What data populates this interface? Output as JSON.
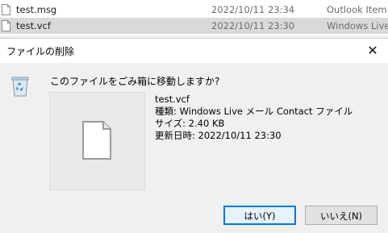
{
  "explorer": {
    "files": [
      {
        "name": "test.msg",
        "date": "2022/10/11 23:34",
        "type": "Outlook Item"
      },
      {
        "name": "test.vcf",
        "date": "2022/10/11 23:30",
        "type": "Windows Live"
      }
    ]
  },
  "dialog": {
    "title": "ファイルの削除",
    "close_glyph": "✕",
    "question": "このファイルをごみ箱に移動しますか?",
    "file": {
      "name": "test.vcf",
      "type_line": "種類: Windows Live メール Contact ファイル",
      "size_line": "サイズ: 2.40 KB",
      "date_line": "更新日時: 2022/10/11 23:30"
    },
    "buttons": {
      "yes": "はい(Y)",
      "no": "いいえ(N)"
    }
  },
  "colors": {
    "accent": "#0078d7",
    "selected_row": "#d9d9d9",
    "dialog_body": "#f0f0f0"
  }
}
